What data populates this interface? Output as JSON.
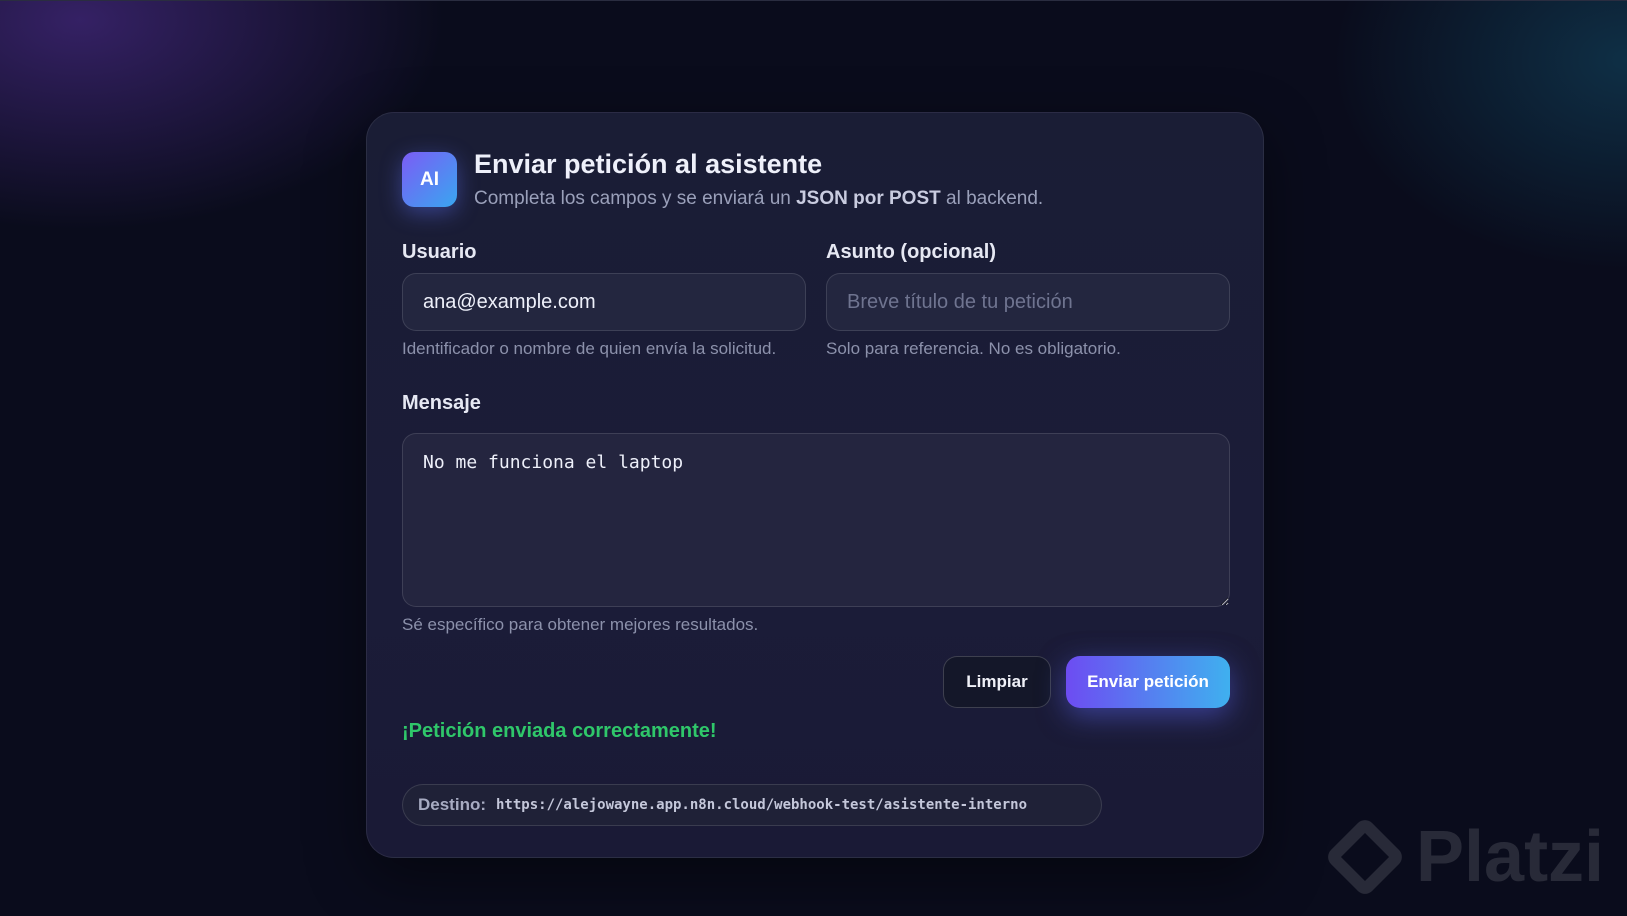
{
  "header": {
    "logo_text": "AI",
    "title": "Enviar petición al asistente",
    "subtitle_pre": "Completa los campos y se enviará un ",
    "subtitle_bold": "JSON por POST",
    "subtitle_post": " al backend."
  },
  "form": {
    "user": {
      "label": "Usuario",
      "value": "ana@example.com",
      "hint": "Identificador o nombre de quien envía la solicitud."
    },
    "subject": {
      "label": "Asunto (opcional)",
      "value": "",
      "placeholder": "Breve título de tu petición",
      "hint": "Solo para referencia. No es obligatorio."
    },
    "message": {
      "label": "Mensaje",
      "value": "No me funciona el laptop",
      "hint": "Sé específico para obtener mejores resultados."
    }
  },
  "actions": {
    "clear_label": "Limpiar",
    "send_label": "Enviar petición"
  },
  "status": {
    "success_text": "¡Petición enviada correctamente!",
    "success_color": "#2fc76a"
  },
  "destination": {
    "label": "Destino:",
    "url": "https://alejowayne.app.n8n.cloud/webhook-test/asistente-interno"
  },
  "watermark": {
    "text": "Platzi",
    "icon": "platzi-logo-icon"
  },
  "theme": {
    "accent_gradient_start": "#6d4cf2",
    "accent_gradient_end": "#3fb0ef",
    "background": "#0a0c1c"
  }
}
